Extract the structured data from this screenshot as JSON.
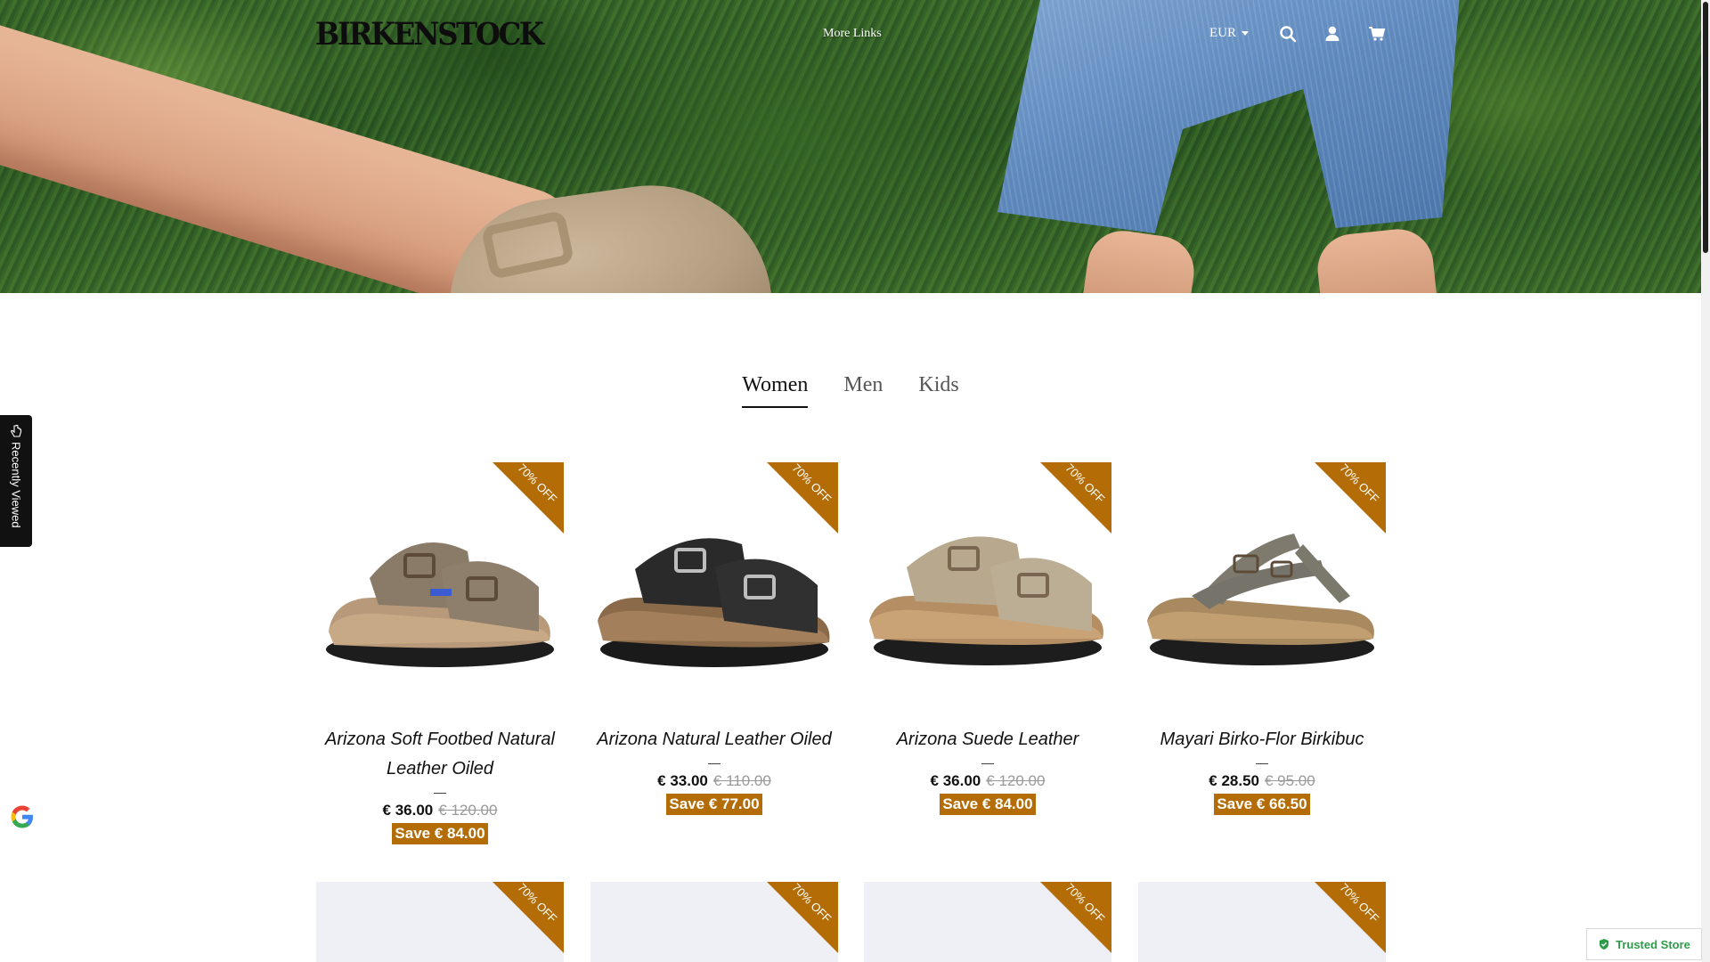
{
  "header": {
    "brand": "BIRKENSTOCK",
    "nav_more": "More Links",
    "currency": "EUR",
    "icons": [
      "search-icon",
      "account-icon",
      "cart-icon"
    ]
  },
  "tabs": [
    {
      "label": "Women",
      "active": true
    },
    {
      "label": "Men",
      "active": false
    },
    {
      "label": "Kids",
      "active": false
    }
  ],
  "products": [
    {
      "title": "Arizona Soft Footbed Natural Leather Oiled",
      "dash": "—",
      "price": "€ 36.00",
      "old_price": "€ 120.00",
      "save": "Save € 84.00",
      "badge": "70% OFF",
      "color": "taupe"
    },
    {
      "title": "Arizona Natural Leather Oiled",
      "dash": "—",
      "price": "€ 33.00",
      "old_price": "€ 110.00",
      "save": "Save € 77.00",
      "badge": "70% OFF",
      "color": "black"
    },
    {
      "title": "Arizona Suede Leather",
      "dash": "—",
      "price": "€ 36.00",
      "old_price": "€ 120.00",
      "save": "Save € 84.00",
      "badge": "70% OFF",
      "color": "sand"
    },
    {
      "title": "Mayari Birko-Flor Birkibuc",
      "dash": "—",
      "price": "€ 28.50",
      "old_price": "€ 95.00",
      "save": "Save € 66.50",
      "badge": "70% OFF",
      "color": "stone"
    }
  ],
  "next_row_badges": [
    "70% OFF",
    "70% OFF",
    "70% OFF",
    "70% OFF"
  ],
  "widgets": {
    "recently_viewed": "Recently Viewed",
    "trusted_store": "Trusted Store"
  },
  "colors": {
    "badge": "#b46d06",
    "trusted": "#2e9b4a"
  }
}
